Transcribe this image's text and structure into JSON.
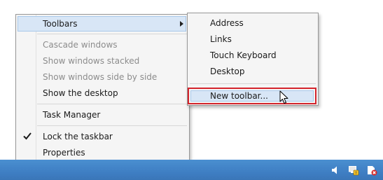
{
  "main_menu": {
    "toolbars": "Toolbars",
    "cascade": "Cascade windows",
    "stacked": "Show windows stacked",
    "side_by_side": "Show windows side by side",
    "show_desktop": "Show the desktop",
    "task_manager": "Task Manager",
    "lock_taskbar": "Lock the taskbar",
    "lock_taskbar_checked": true,
    "properties": "Properties"
  },
  "toolbars_submenu": {
    "address": "Address",
    "links": "Links",
    "touch_keyboard": "Touch Keyboard",
    "desktop": "Desktop",
    "new_toolbar": "New toolbar..."
  },
  "tray_icons": [
    "speaker-icon",
    "network-icon",
    "action-center-icon"
  ],
  "colors": {
    "taskbar": "#3f7fc4",
    "highlight": "#d8e6f6",
    "callout": "#d4242c"
  }
}
